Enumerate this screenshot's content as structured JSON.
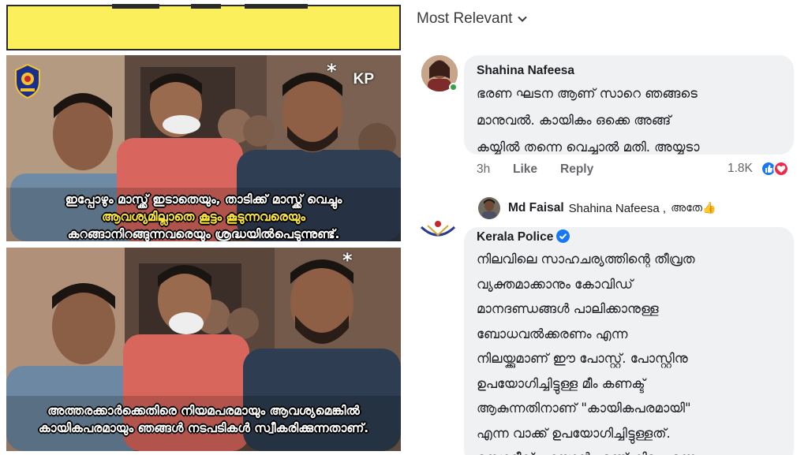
{
  "meme": {
    "kp_mark": "KP",
    "star_mark": "*",
    "caption_top_line1": "ഇപ്പോഴും മാസ്ക്ക് ഇടാതെയും, താടിക്ക് മാസ്ക്ക് വെച്ചും",
    "caption_top_line2": "ആവശ്യമില്ലാതെ കൂട്ടം കൂടുന്നവരെയും",
    "caption_top_line3": "കറങ്ങാനിറങ്ങുന്നവരെയും ശ്രദ്ധയിൽപെടുന്നുണ്ട്.",
    "caption_bottom_line1": "അത്തരക്കാർക്കെതിരെ നിയമപരമായും ആവശ്യമെങ്കിൽ",
    "caption_bottom_line2": "കായികപരമായും ഞങ്ങൾ നടപടികൾ സ്വീകരിക്കുന്നതാണ്."
  },
  "comments_panel": {
    "sort_label": "Most Relevant",
    "comment1": {
      "author": "Shahina Nafeesa",
      "lines": [
        "ഭരണ ഘടന ആണ് സാറെ ഞങ്ങടെ",
        "മാനുവൽ. കായികം ഒക്കെ അങ്ങ്",
        "കയ്യിൽ തന്നെ വെച്ചാൽ മതി. അയ്യടാ"
      ],
      "time": "3h",
      "like_label": "Like",
      "reply_label": "Reply",
      "reaction_count": "1.8K",
      "reactions": [
        "like-icon",
        "love-icon"
      ]
    },
    "reply1": {
      "author": "Md Faisal",
      "mention": "Shahina Nafeesa ,",
      "text": "അതേ👍"
    },
    "comment2": {
      "author": "Kerala Police",
      "lines": [
        "നിലവിലെ സാഹചര്യത്തിന്റെ തീവ്രത",
        "വ്യക്തമാക്കാനും കോവിഡ്",
        "മാനദണ്ഡങ്ങൾ പാലിക്കാനുള്ള",
        "ബോധവൽക്കരണം എന്ന",
        "നിലയ്ക്കുമാണ് ഈ പോസ്റ്റ്.  പോസ്റ്റിനു",
        "ഉപയോഗിച്ചിട്ടുള്ള മീം കണക്ട്",
        "ആകുന്നതിനാണ് \"കായികപരമായി\"",
        "എന്ന വാക്ക് ഉപയോഗിച്ചിട്ടുള്ളത്.",
        "നെഗറ്റീവ് പറയാൻ എന്ത് കിട്ടും എന്ന"
      ]
    }
  },
  "colors": {
    "banner_yellow": "#fbef5b",
    "bubble_gray": "#eff1f3",
    "meta_gray": "#65676b",
    "facebook_blue": "#1877f2",
    "love_red": "#f02849",
    "online_green": "#31a24c",
    "caption_yellow": "#fbe53a"
  }
}
